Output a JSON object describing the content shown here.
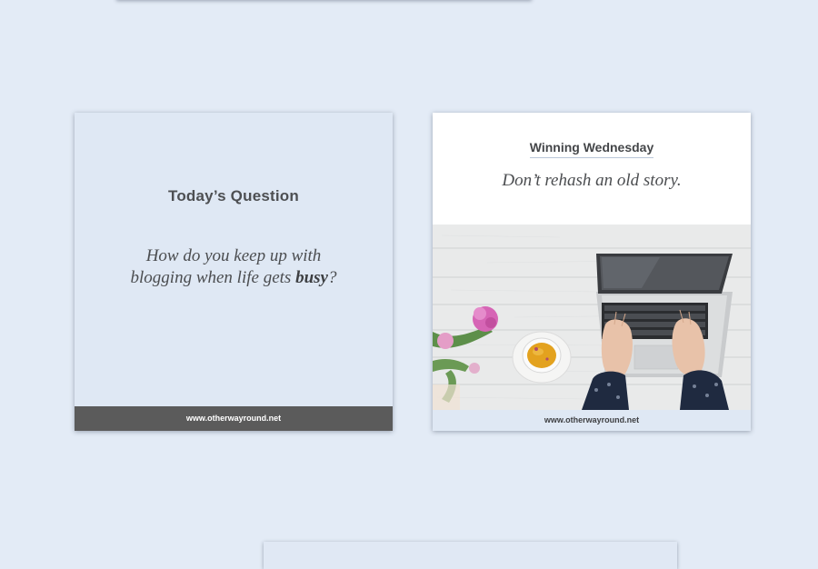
{
  "question_card": {
    "title": "Today’s Question",
    "line1": "How do you keep up with",
    "line2_prefix": "blogging when life gets ",
    "line2_bold": "busy",
    "line2_suffix": "?",
    "footer_url": "www.otherwayround.net"
  },
  "wednesday_card": {
    "title": "Winning Wednesday",
    "subtitle": "Don’t rehash an old story.",
    "footer_url": "www.otherwayround.net"
  },
  "colors": {
    "page_background": "#e3ebf6",
    "card_light_blue": "#dfe8f4",
    "footer_dark": "#5b5b5b",
    "text_gray": "#4b4d50"
  }
}
